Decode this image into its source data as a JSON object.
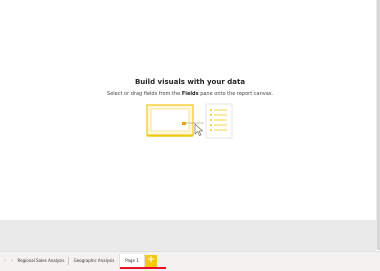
{
  "empty_state": {
    "title": "Build visuals with your data",
    "subtitle_before": "Select or drag fields from the ",
    "subtitle_bold": "Fields",
    "subtitle_after": " pane onto the report canvas."
  },
  "tabs": [
    {
      "label": "Regional Sales Analysis"
    },
    {
      "label": "Geographic Analysis"
    },
    {
      "label": "Page 1",
      "active": true
    }
  ],
  "add_page_label": "+",
  "nav": {
    "prev": "‹",
    "next": "›"
  },
  "colors": {
    "accent": "#f2c811",
    "active_indicator": "#e81123",
    "band": "#eaeaea"
  },
  "icons": [
    "chevron-left-icon",
    "chevron-right-icon",
    "plus-icon",
    "cursor-icon",
    "fields-list-icon",
    "visual-placeholder-icon"
  ]
}
